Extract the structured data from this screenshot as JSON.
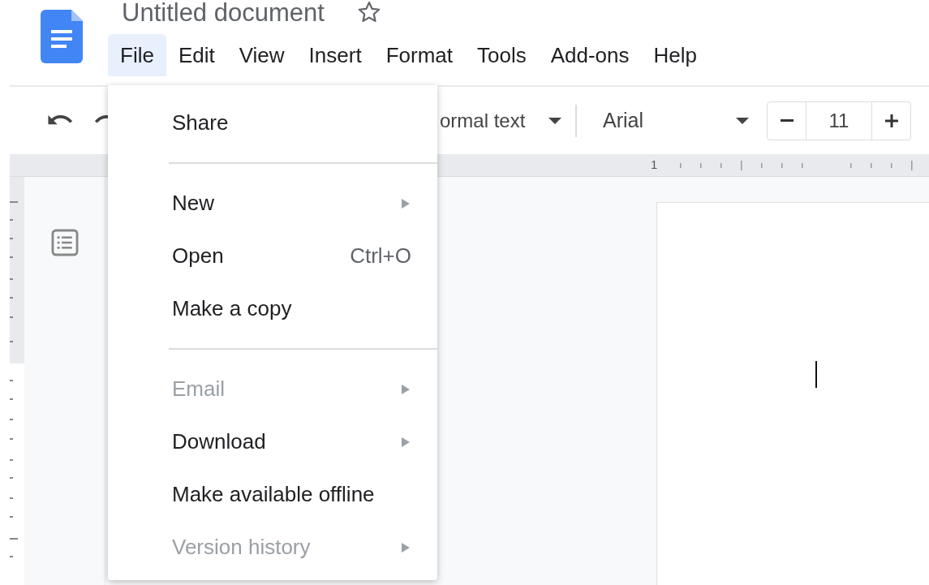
{
  "app": {
    "title": "Untitled document",
    "starred": false
  },
  "menu_bar": [
    {
      "label": "File",
      "selected": true
    },
    {
      "label": "Edit",
      "selected": false
    },
    {
      "label": "View",
      "selected": false
    },
    {
      "label": "Insert",
      "selected": false
    },
    {
      "label": "Format",
      "selected": false
    },
    {
      "label": "Tools",
      "selected": false
    },
    {
      "label": "Add-ons",
      "selected": false
    },
    {
      "label": "Help",
      "selected": false
    }
  ],
  "toolbar": {
    "style": "ormal text",
    "font": "Arial",
    "font_size": "11"
  },
  "ruler": {
    "label": "1"
  },
  "file_menu": [
    {
      "kind": "item",
      "label": "Share",
      "disabled": false,
      "submenu": false
    },
    {
      "kind": "divider"
    },
    {
      "kind": "item",
      "label": "New",
      "disabled": false,
      "submenu": true
    },
    {
      "kind": "item",
      "label": "Open",
      "disabled": false,
      "submenu": false,
      "shortcut": "Ctrl+O"
    },
    {
      "kind": "item",
      "label": "Make a copy",
      "disabled": false,
      "submenu": false
    },
    {
      "kind": "divider"
    },
    {
      "kind": "item",
      "label": "Email",
      "disabled": true,
      "submenu": true
    },
    {
      "kind": "item",
      "label": "Download",
      "disabled": false,
      "submenu": true
    },
    {
      "kind": "item",
      "label": "Make available offline",
      "disabled": false,
      "submenu": false
    },
    {
      "kind": "item",
      "label": "Version history",
      "disabled": true,
      "submenu": true
    }
  ]
}
